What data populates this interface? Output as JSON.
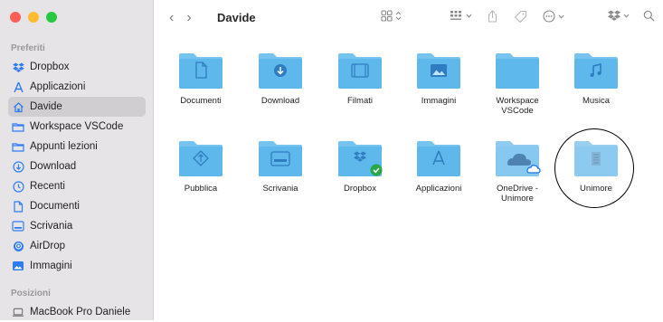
{
  "window": {
    "traffic_colors": {
      "close": "#ff5f57",
      "minimize": "#febc2e",
      "zoom": "#28c840"
    },
    "title": "Davide"
  },
  "sidebar": {
    "favorites_title": "Preferiti",
    "favorites": [
      {
        "label": "Dropbox",
        "icon": "dropbox-icon"
      },
      {
        "label": "Applicazioni",
        "icon": "applications-icon"
      },
      {
        "label": "Davide",
        "icon": "home-icon",
        "active": true
      },
      {
        "label": "Workspace VSCode",
        "icon": "folder-icon"
      },
      {
        "label": "Appunti lezioni",
        "icon": "folder-icon"
      },
      {
        "label": "Download",
        "icon": "download-icon"
      },
      {
        "label": "Recenti",
        "icon": "clock-icon"
      },
      {
        "label": "Documenti",
        "icon": "document-icon"
      },
      {
        "label": "Scrivania",
        "icon": "desktop-icon"
      },
      {
        "label": "AirDrop",
        "icon": "airdrop-icon"
      },
      {
        "label": "Immagini",
        "icon": "photos-icon"
      }
    ],
    "locations_title": "Posizioni",
    "locations": [
      {
        "label": "MacBook Pro Daniele",
        "icon": "laptop-icon"
      }
    ]
  },
  "items": [
    {
      "label": "Documenti",
      "glyph": "document"
    },
    {
      "label": "Download",
      "glyph": "download"
    },
    {
      "label": "Filmati",
      "glyph": "film"
    },
    {
      "label": "Immagini",
      "glyph": "photo"
    },
    {
      "label": "Workspace\nVSCode",
      "glyph": "plain"
    },
    {
      "label": "Musica",
      "glyph": "music"
    },
    {
      "label": "Pubblica",
      "glyph": "public"
    },
    {
      "label": "Scrivania",
      "glyph": "desktop"
    },
    {
      "label": "Dropbox",
      "glyph": "dropbox"
    },
    {
      "label": "Applicazioni",
      "glyph": "apps"
    },
    {
      "label": "OneDrive -\nUnimore",
      "glyph": "onedrive"
    },
    {
      "label": "Unimore",
      "glyph": "unimore"
    }
  ],
  "colors": {
    "folder": "#5fb8ec",
    "folder_dark": "#4aa7e0",
    "sidebar_accent": "#2f7cf6"
  }
}
